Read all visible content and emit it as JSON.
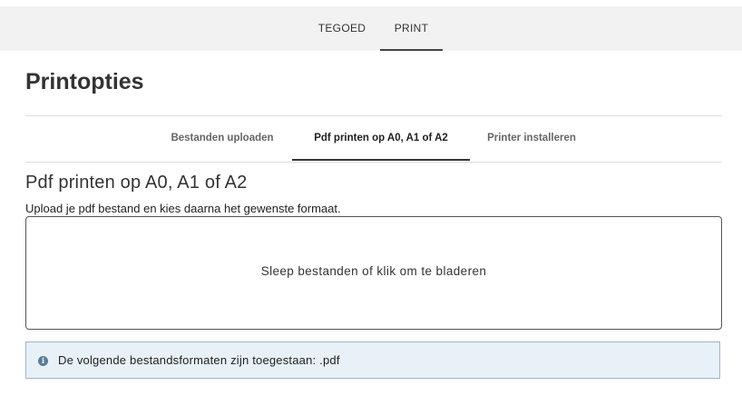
{
  "topnav": {
    "items": [
      {
        "label": "TEGOED",
        "active": false
      },
      {
        "label": "PRINT",
        "active": true
      }
    ]
  },
  "page": {
    "title": "Printopties"
  },
  "subtabs": [
    {
      "label": "Bestanden uploaden",
      "active": false
    },
    {
      "label": "Pdf printen op A0, A1 of A2",
      "active": true
    },
    {
      "label": "Printer installeren",
      "active": false
    }
  ],
  "section": {
    "title": "Pdf printen op A0, A1 of A2",
    "description": "Upload je pdf bestand en kies daarna het gewenste formaat."
  },
  "dropzone": {
    "text": "Sleep bestanden of klik om te bladeren"
  },
  "info": {
    "icon": "info-icon",
    "text": "De volgende bestandsformaten zijn toegestaan: .pdf"
  }
}
